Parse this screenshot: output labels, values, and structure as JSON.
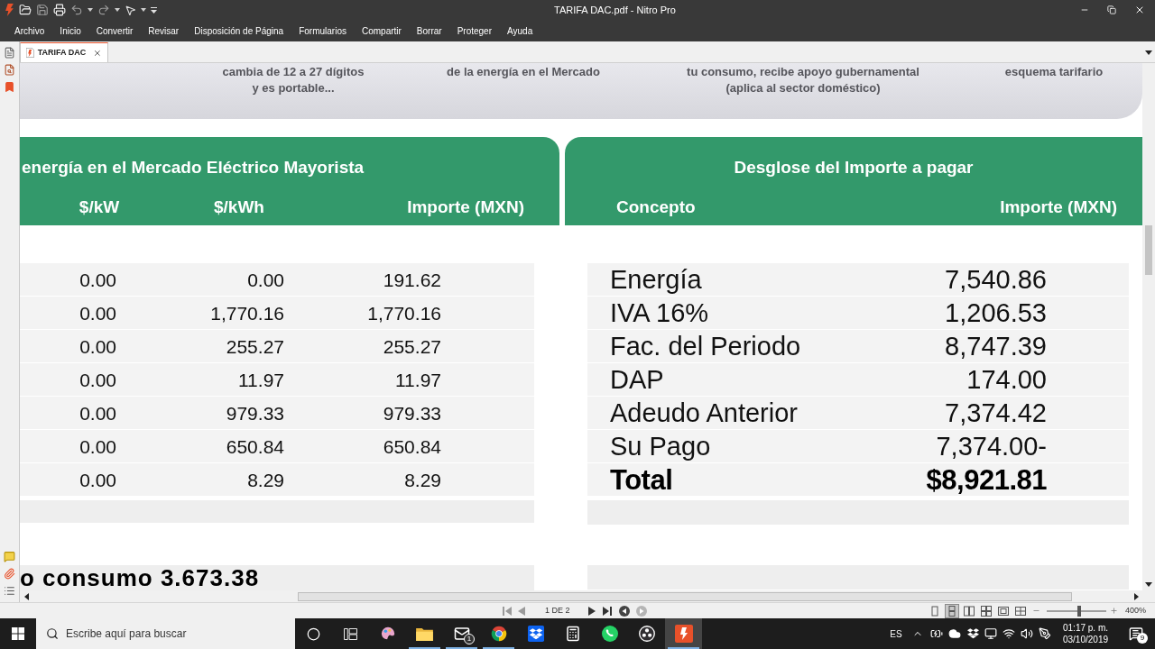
{
  "window": {
    "title": "TARIFA DAC.pdf - Nitro Pro"
  },
  "menu": [
    "Archivo",
    "Inicio",
    "Convertir",
    "Revisar",
    "Disposición de Página",
    "Formularios",
    "Compartir",
    "Borrar",
    "Proteger",
    "Ayuda"
  ],
  "tabs": [
    {
      "label": "TARIFA DAC",
      "selected": true
    }
  ],
  "document": {
    "banner": [
      {
        "lines": [
          "cambia de 12 a 27 dígitos",
          "y es portable..."
        ]
      },
      {
        "lines": [
          "de la energía en el Mercado"
        ]
      },
      {
        "lines": [
          "tu consumo, recibe apoyo gubernamental",
          "(aplica al sector doméstico)"
        ]
      },
      {
        "lines": [
          "esquema tarifario"
        ]
      }
    ],
    "market_table": {
      "title": "energía en el Mercado Eléctrico Mayorista",
      "columns": [
        "$/kW",
        "$/kWh",
        "Importe (MXN)"
      ],
      "rows": [
        [
          "0.00",
          "0.00",
          "191.62"
        ],
        [
          "0.00",
          "1,770.16",
          "1,770.16"
        ],
        [
          "0.00",
          "255.27",
          "255.27"
        ],
        [
          "0.00",
          "11.97",
          "11.97"
        ],
        [
          "0.00",
          "979.33",
          "979.33"
        ],
        [
          "0.00",
          "650.84",
          "650.84"
        ],
        [
          "0.00",
          "8.29",
          "8.29"
        ]
      ]
    },
    "breakdown_table": {
      "title": "Desglose del Importe a pagar",
      "columns": [
        "Concepto",
        "Importe (MXN)"
      ],
      "rows": [
        {
          "kind": "item",
          "concept": "Energía",
          "amount": "7,540.86"
        },
        {
          "kind": "item",
          "concept": "IVA 16%",
          "amount": "1,206.53"
        },
        {
          "kind": "item",
          "concept": "Fac. del Periodo",
          "amount": "8,747.39"
        },
        {
          "kind": "item",
          "concept": "DAP",
          "amount": "174.00"
        },
        {
          "kind": "item",
          "concept": "Adeudo Anterior",
          "amount": "7,374.42"
        },
        {
          "kind": "item",
          "concept": "Su Pago",
          "amount": "7,374.00-"
        },
        {
          "kind": "total",
          "concept": "Total",
          "amount": "$8,921.81"
        }
      ]
    },
    "summary_text": "o consumo 3.673.38"
  },
  "status_bar": {
    "page": "1 DE 2",
    "view_modes": [
      {
        "selected": false
      },
      {
        "selected": true
      },
      {
        "selected": false
      },
      {
        "selected": false
      },
      {
        "selected": false
      },
      {
        "selected": false
      }
    ],
    "zoom_slider": {
      "level": 0.55
    },
    "zoom": "400%"
  },
  "taskbar": {
    "search": {
      "placeholder": "Escribe aquí para buscar"
    },
    "apps": [
      {
        "running": false,
        "active": false
      },
      {
        "running": true,
        "active": false
      },
      {
        "running": true,
        "active": false,
        "badge": "1"
      },
      {
        "running": true,
        "active": false
      },
      {
        "running": false,
        "active": false
      },
      {
        "running": false,
        "active": false
      },
      {
        "running": false,
        "active": false
      },
      {
        "running": false,
        "active": false
      },
      {
        "running": true,
        "active": true
      }
    ],
    "language": "ES",
    "time": "01:17 p. m.",
    "date": "03/10/2019",
    "notifications": "9"
  }
}
